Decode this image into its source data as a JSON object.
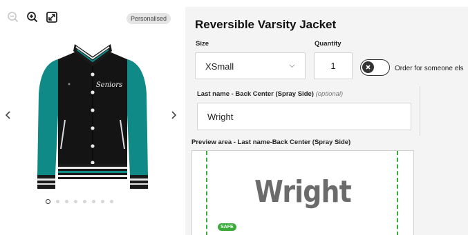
{
  "gallery": {
    "badge": "Personalised",
    "dots_total": 8,
    "active_dot": 0
  },
  "product": {
    "title": "Reversible Varsity Jacket",
    "jacket_chest_text": "Seniors"
  },
  "form": {
    "size_label": "Size",
    "size_value": "XSmall",
    "quantity_label": "Quantity",
    "quantity_value": "1",
    "toggle_label": "Order for someone els",
    "lastname_label": "Last name - Back Center (Spray Side)",
    "lastname_optional": "(optional)",
    "lastname_value": "Wright",
    "preview_label": "Preview area - Last name-Back Center (Spray Side)",
    "preview_text": "Wright",
    "safe_badge": "SAFE"
  },
  "colors": {
    "sleeve": "#0f8a86",
    "body": "#141414",
    "safe_green": "#3aab3a"
  }
}
